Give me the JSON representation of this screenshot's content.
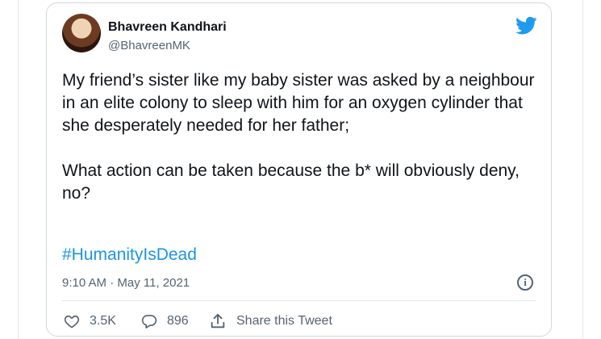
{
  "tweet": {
    "author_name": "Bhavreen Kandhari",
    "author_handle": "@BhavreenMK",
    "paragraph_1": "My friend’s sister like my baby sister was asked by a neighbour in an elite colony to sleep with him for an oxygen cylinder that she desperately needed for her father;",
    "paragraph_2": "What action can be taken because the b* will obviously deny, no?",
    "hashtag": "#HumanityIsDead",
    "timestamp": "9:10 AM · May 11, 2021",
    "info_symbol": "i"
  },
  "actions": {
    "likes": "3.5K",
    "replies": "896",
    "share_label": "Share this Tweet"
  },
  "icons": {
    "brand": "twitter-bird-icon",
    "like": "heart-icon",
    "reply": "speech-bubble-icon",
    "share": "share-upload-icon",
    "info": "info-icon"
  },
  "colors": {
    "brand_blue": "#1d9bf0",
    "hashtag_blue": "#1b95e0",
    "secondary_text": "#536471"
  }
}
